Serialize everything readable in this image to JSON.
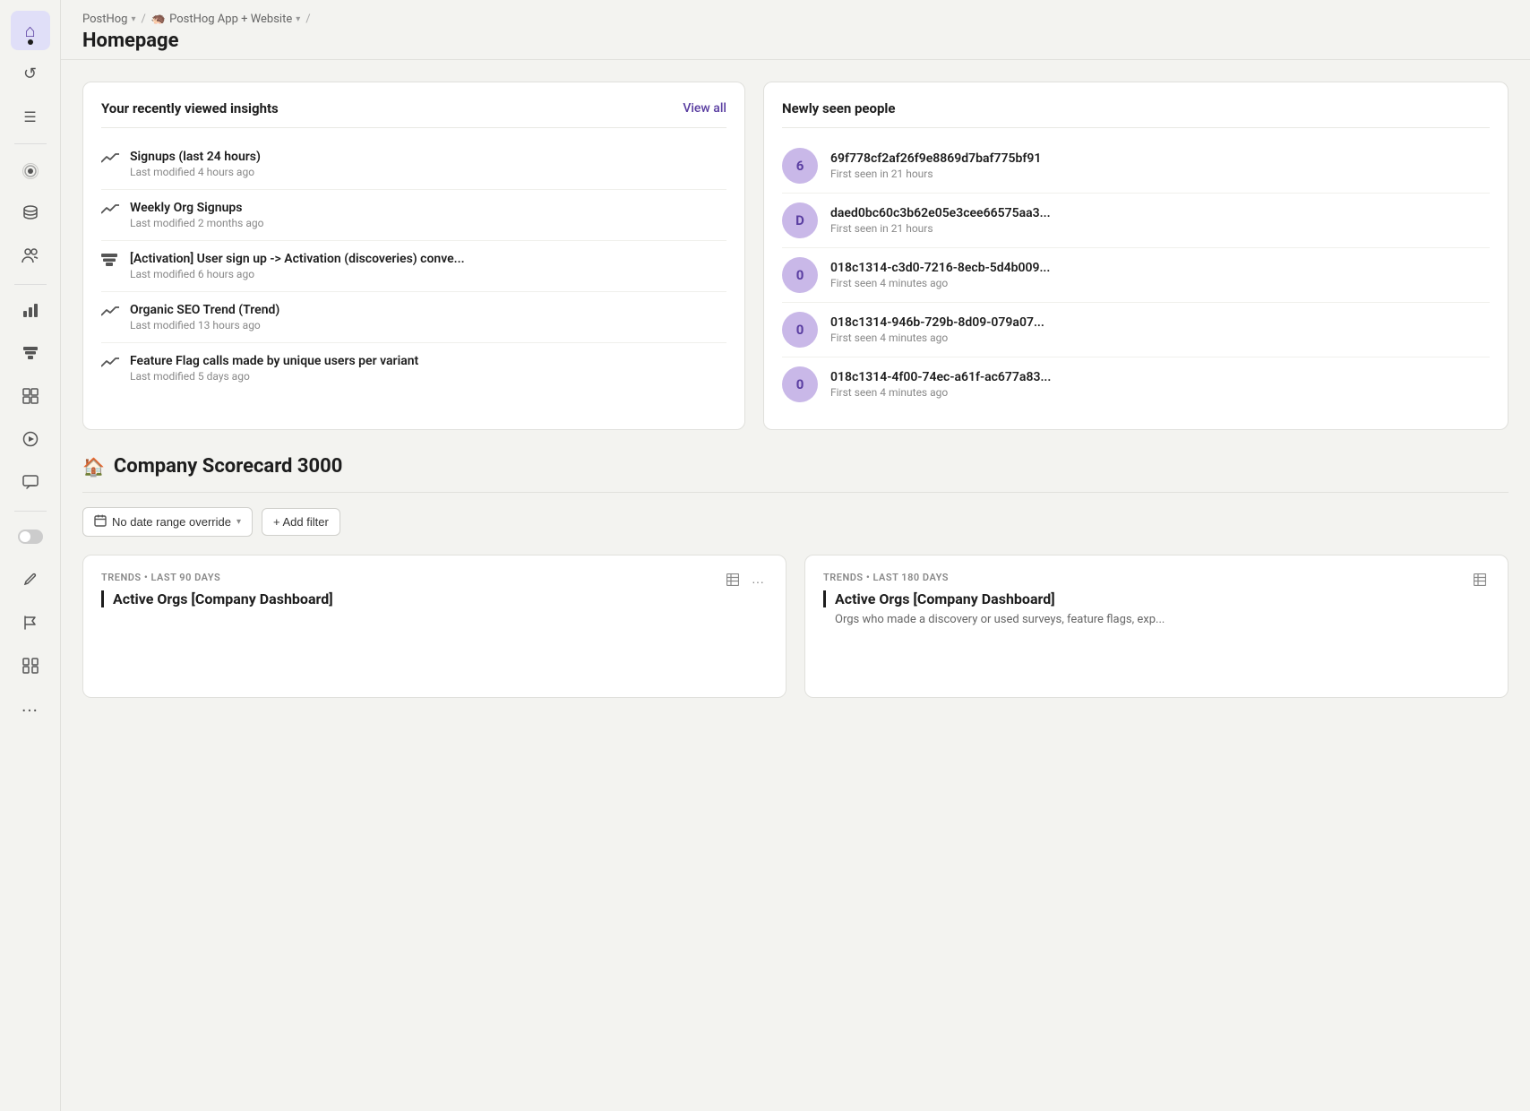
{
  "breadcrumb": {
    "org": "PostHog",
    "project": "PostHog App + Website",
    "separator": "/"
  },
  "header": {
    "title": "Homepage"
  },
  "recently_viewed": {
    "title": "Your recently viewed insights",
    "view_all": "View all",
    "insights": [
      {
        "name": "Signups (last 24 hours)",
        "meta": "Last modified 4 hours ago",
        "type": "trend"
      },
      {
        "name": "Weekly Org Signups",
        "meta": "Last modified 2 months ago",
        "type": "trend"
      },
      {
        "name": "[Activation] User sign up -> Activation (discoveries) conve...",
        "meta": "Last modified 6 hours ago",
        "type": "funnel"
      },
      {
        "name": "Organic SEO Trend (Trend)",
        "meta": "Last modified 13 hours ago",
        "type": "trend"
      },
      {
        "name": "Feature Flag calls made by unique users per variant",
        "meta": "Last modified 5 days ago",
        "type": "trend"
      }
    ]
  },
  "newly_seen": {
    "title": "Newly seen people",
    "people": [
      {
        "avatar_label": "6",
        "id": "69f778cf2af26f9e8869d7baf775bf91",
        "seen": "First seen in 21 hours"
      },
      {
        "avatar_label": "D",
        "id": "daed0bc60c3b62e05e3cee66575aa3...",
        "seen": "First seen in 21 hours"
      },
      {
        "avatar_label": "0",
        "id": "018c1314-c3d0-7216-8ecb-5d4b009...",
        "seen": "First seen 4 minutes ago"
      },
      {
        "avatar_label": "0",
        "id": "018c1314-946b-729b-8d09-079a07...",
        "seen": "First seen 4 minutes ago"
      },
      {
        "avatar_label": "0",
        "id": "018c1314-4f00-74ec-a61f-ac677a83...",
        "seen": "First seen 4 minutes ago"
      }
    ]
  },
  "scorecard": {
    "title": "Company Scorecard 3000",
    "icon": "🏠"
  },
  "filters": {
    "date_range": "No date range override",
    "add_filter": "+ Add filter"
  },
  "dashboard_cards": [
    {
      "label": "TRENDS • LAST 90 DAYS",
      "title": "Active Orgs [Company Dashboard]",
      "description": ""
    },
    {
      "label": "TRENDS • LAST 180 DAYS",
      "title": "Active Orgs [Company Dashboard]",
      "description": "Orgs who made a discovery or used surveys, feature flags, exp..."
    }
  ],
  "sidebar": {
    "items": [
      {
        "icon": "⌂",
        "name": "home",
        "active": true
      },
      {
        "icon": "↺",
        "name": "activity"
      },
      {
        "icon": "☰",
        "name": "data-management"
      },
      {
        "icon": "◎",
        "name": "live-events"
      },
      {
        "icon": "⬡",
        "name": "database"
      },
      {
        "icon": "👥",
        "name": "persons"
      },
      {
        "icon": "▦",
        "name": "insights"
      },
      {
        "icon": "◑",
        "name": "funnels"
      },
      {
        "icon": "▤",
        "name": "experiments"
      },
      {
        "icon": "▷",
        "name": "replays"
      },
      {
        "icon": "💬",
        "name": "surveys"
      },
      {
        "icon": "◐",
        "name": "dark-mode"
      },
      {
        "icon": "✏",
        "name": "annotations"
      },
      {
        "icon": "🔖",
        "name": "feature-flags"
      },
      {
        "icon": "⊞",
        "name": "apps"
      },
      {
        "icon": "…",
        "name": "more"
      }
    ]
  }
}
